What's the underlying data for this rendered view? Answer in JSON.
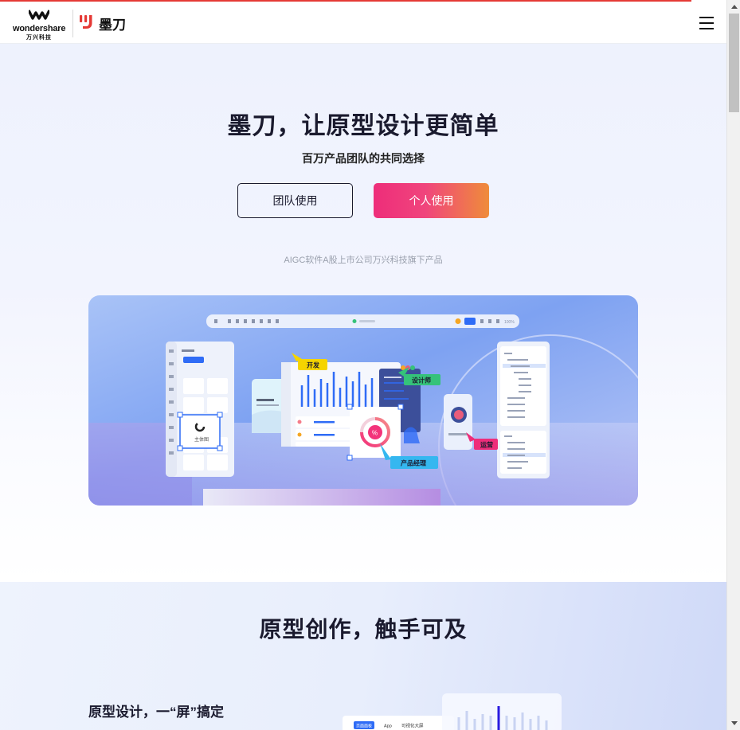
{
  "header": {
    "brand_name": "wondershare",
    "brand_cn": "万兴科技",
    "product_name": "墨刀",
    "menu_icon": "hamburger-menu-icon"
  },
  "hero": {
    "title": "墨刀，让原型设计更简单",
    "subtitle": "百万产品团队的共同选择",
    "team_button": "团队使用",
    "personal_button": "个人使用",
    "note": "AIGC软件A股上市公司万兴科技旗下产品"
  },
  "hero_image": {
    "tag_dev": "开发",
    "tag_designer": "设计师",
    "tag_pm": "产品经理",
    "tag_ops": "运营",
    "card_label": "主体图",
    "zoom": "100%",
    "badge": "%",
    "accent": "#2f6cf6"
  },
  "section2": {
    "title": "原型创作，触手可及",
    "feature_title": "原型设计，一“屏”搞定",
    "preview_tab1": "页面面板",
    "preview_tab2": "App",
    "preview_tab3": "可视化大屏"
  },
  "colors": {
    "brand_red": "#e53935",
    "gradient_start": "#ee2d7a",
    "gradient_end": "#ef8c3a",
    "text_dark": "#1a1a2e"
  }
}
